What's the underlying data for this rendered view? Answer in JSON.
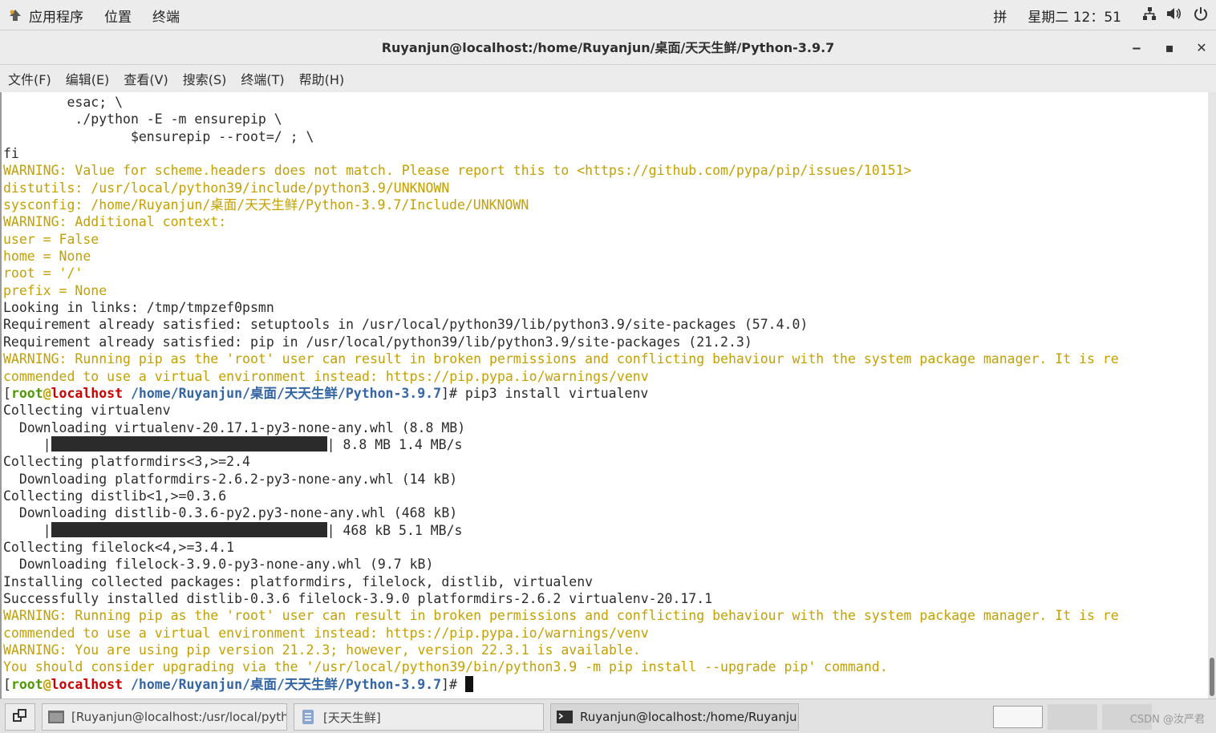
{
  "topbar": {
    "menus": [
      "应用程序",
      "位置",
      "终端"
    ],
    "input_method": "拼",
    "clock": "星期二 12：51"
  },
  "window": {
    "title": "Ruyanjun@localhost:/home/Ruyanjun/桌面/天天生鲜/Python-3.9.7",
    "minimize_glyph": "‒",
    "maximize_glyph": "▪",
    "close_glyph": "✕"
  },
  "menubar": [
    "文件(F)",
    "编辑(E)",
    "查看(V)",
    "搜索(S)",
    "终端(T)",
    "帮助(H)"
  ],
  "terminal": {
    "lines": [
      {
        "s": [
          {
            "t": "        esac; \\",
            "c": "n"
          }
        ]
      },
      {
        "s": [
          {
            "t": "         ./python -E -m ensurepip \\",
            "c": "n"
          }
        ]
      },
      {
        "s": [
          {
            "t": "                $ensurepip --root=/ ; \\",
            "c": "n"
          }
        ]
      },
      {
        "s": [
          {
            "t": "fi",
            "c": "n"
          }
        ]
      },
      {
        "s": [
          {
            "t": "WARNING: Value for scheme.headers does not match. Please report this to <https://github.com/pypa/pip/issues/10151>",
            "c": "w"
          }
        ]
      },
      {
        "s": [
          {
            "t": "distutils: /usr/local/python39/include/python3.9/UNKNOWN",
            "c": "w"
          }
        ]
      },
      {
        "s": [
          {
            "t": "sysconfig: /home/Ruyanjun/桌面/天天生鲜/Python-3.9.7/Include/UNKNOWN",
            "c": "w"
          }
        ]
      },
      {
        "s": [
          {
            "t": "WARNING: Additional context:",
            "c": "w"
          }
        ]
      },
      {
        "s": [
          {
            "t": "user = False",
            "c": "w"
          }
        ]
      },
      {
        "s": [
          {
            "t": "home = None",
            "c": "w"
          }
        ]
      },
      {
        "s": [
          {
            "t": "root = '/'",
            "c": "w"
          }
        ]
      },
      {
        "s": [
          {
            "t": "prefix = None",
            "c": "w"
          }
        ]
      },
      {
        "s": [
          {
            "t": "Looking in links: /tmp/tmpzef0psmn",
            "c": "n"
          }
        ]
      },
      {
        "s": [
          {
            "t": "Requirement already satisfied: setuptools in /usr/local/python39/lib/python3.9/site-packages (57.4.0)",
            "c": "n"
          }
        ]
      },
      {
        "s": [
          {
            "t": "Requirement already satisfied: pip in /usr/local/python39/lib/python3.9/site-packages (21.2.3)",
            "c": "n"
          }
        ]
      },
      {
        "s": [
          {
            "t": "WARNING: Running pip as the 'root' user can result in broken permissions and conflicting behaviour with the system package manager. It is re",
            "c": "w"
          }
        ]
      },
      {
        "s": [
          {
            "t": "commended to use a virtual environment instead: https://pip.pypa.io/warnings/venv",
            "c": "w"
          }
        ]
      },
      {
        "s": [
          {
            "t": "[",
            "c": "n"
          },
          {
            "t": "root",
            "c": "u"
          },
          {
            "t": "@",
            "c": "at"
          },
          {
            "t": "localhost",
            "c": "h"
          },
          {
            "t": " /home/Ruyanjun/桌面/天天生鲜/Python-3.9.7",
            "c": "p"
          },
          {
            "t": "]# pip3 install virtualenv",
            "c": "n"
          }
        ]
      },
      {
        "s": [
          {
            "t": "Collecting virtualenv",
            "c": "n"
          }
        ]
      },
      {
        "s": [
          {
            "t": "  Downloading virtualenv-20.17.1-py3-none-any.whl (8.8 MB)",
            "c": "n"
          }
        ]
      },
      {
        "s": [
          {
            "t": "     |",
            "c": "n"
          },
          {
            "t": "",
            "c": "bar"
          },
          {
            "t": "| 8.8 MB 1.4 MB/s",
            "c": "n"
          }
        ]
      },
      {
        "s": [
          {
            "t": "Collecting platformdirs<3,>=2.4",
            "c": "n"
          }
        ]
      },
      {
        "s": [
          {
            "t": "  Downloading platformdirs-2.6.2-py3-none-any.whl (14 kB)",
            "c": "n"
          }
        ]
      },
      {
        "s": [
          {
            "t": "Collecting distlib<1,>=0.3.6",
            "c": "n"
          }
        ]
      },
      {
        "s": [
          {
            "t": "  Downloading distlib-0.3.6-py2.py3-none-any.whl (468 kB)",
            "c": "n"
          }
        ]
      },
      {
        "s": [
          {
            "t": "     |",
            "c": "n"
          },
          {
            "t": "",
            "c": "bar"
          },
          {
            "t": "| 468 kB 5.1 MB/s",
            "c": "n"
          }
        ]
      },
      {
        "s": [
          {
            "t": "Collecting filelock<4,>=3.4.1",
            "c": "n"
          }
        ]
      },
      {
        "s": [
          {
            "t": "  Downloading filelock-3.9.0-py3-none-any.whl (9.7 kB)",
            "c": "n"
          }
        ]
      },
      {
        "s": [
          {
            "t": "Installing collected packages: platformdirs, filelock, distlib, virtualenv",
            "c": "n"
          }
        ]
      },
      {
        "s": [
          {
            "t": "Successfully installed distlib-0.3.6 filelock-3.9.0 platformdirs-2.6.2 virtualenv-20.17.1",
            "c": "n"
          }
        ]
      },
      {
        "s": [
          {
            "t": "WARNING: Running pip as the 'root' user can result in broken permissions and conflicting behaviour with the system package manager. It is re",
            "c": "w"
          }
        ]
      },
      {
        "s": [
          {
            "t": "commended to use a virtual environment instead: https://pip.pypa.io/warnings/venv",
            "c": "w"
          }
        ]
      },
      {
        "s": [
          {
            "t": "WARNING: You are using pip version 21.2.3; however, version 22.3.1 is available.",
            "c": "w"
          }
        ]
      },
      {
        "s": [
          {
            "t": "You should consider upgrading via the '/usr/local/python39/bin/python3.9 -m pip install --upgrade pip' command.",
            "c": "w"
          }
        ]
      },
      {
        "s": [
          {
            "t": "[",
            "c": "n"
          },
          {
            "t": "root",
            "c": "u"
          },
          {
            "t": "@",
            "c": "at"
          },
          {
            "t": "localhost",
            "c": "h"
          },
          {
            "t": " /home/Ruyanjun/桌面/天天生鲜/Python-3.9.7",
            "c": "p"
          },
          {
            "t": "]# ",
            "c": "n"
          },
          {
            "t": "",
            "c": "cur"
          }
        ]
      }
    ]
  },
  "taskbar": {
    "tasks": [
      {
        "label": "[Ruyanjun@localhost:/usr/local/pyth···",
        "icon": "terminal-icon"
      },
      {
        "label": "[天天生鲜]",
        "icon": "file-manager-icon"
      },
      {
        "label": "Ruyanjun@localhost:/home/Ruyanju···",
        "icon": "terminal-icon"
      }
    ],
    "watermark": "CSDN @汝严君"
  },
  "colors": {
    "warning": "#c4a000",
    "prompt_user": "#4e9a06",
    "prompt_host": "#cc0000",
    "prompt_path": "#3465a4"
  }
}
